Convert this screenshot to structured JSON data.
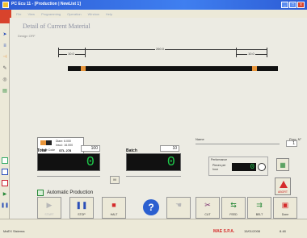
{
  "titlebar": {
    "title": "PC Ecu 11 - [Production | NewList 1]",
    "controls": [
      "_",
      "□",
      "x"
    ]
  },
  "menu": {
    "items": [
      "File",
      "View",
      "Programming",
      "Operation",
      "Window",
      "Help"
    ]
  },
  "header": {
    "title": "Detail of Current Material",
    "view_label": "Design OFF"
  },
  "dimensions": {
    "left": "10.0",
    "total": "260.0",
    "right": "10.0"
  },
  "material": {
    "line1": "Diam: 6.000",
    "line2": "Insul.: 16.000",
    "code_label": "Value Code",
    "code_value": "STL 278"
  },
  "colors": {
    "accent": "#1ec84a",
    "bar": "#111111",
    "strip": "#e8953a",
    "title": "#2c5bd4"
  },
  "counters": {
    "total": {
      "label": "Total",
      "set_value": "100",
      "current": "0"
    },
    "batch": {
      "label": "Batch",
      "set_value": "10",
      "current": "0"
    },
    "middle_button": "M"
  },
  "program": {
    "name_label": "Name",
    "prog_label": "Prog. N°",
    "prog_value": "1"
  },
  "performance": {
    "title": "Performance",
    "line1": "Pieces per",
    "line2": "hour",
    "value": "0"
  },
  "warning": {
    "label": "ABORT"
  },
  "auto_production": {
    "label": "Automatic Production"
  },
  "actions": [
    {
      "label": "START",
      "icon": "play-icon",
      "glyph": "▶",
      "color": "#b8b8b8",
      "disabled": true
    },
    {
      "label": "STOP",
      "icon": "pause-icon",
      "glyph": "❚❚",
      "color": "#2b4fb8",
      "disabled": false
    },
    {
      "label": "HALT",
      "icon": "stop-icon",
      "glyph": "■",
      "color": "#d52b2b",
      "disabled": false
    },
    {
      "label": "",
      "icon": "hand-icon",
      "glyph": "☚",
      "color": "#b8b8b8",
      "disabled": true
    },
    {
      "label": "CUT",
      "icon": "cut-icon",
      "glyph": "✂",
      "color": "#7a2e6e",
      "disabled": false
    },
    {
      "label": "FEED",
      "icon": "feed-icon",
      "glyph": "⇆",
      "color": "#2a8a3a",
      "disabled": false
    },
    {
      "label": "BELT",
      "icon": "belt-icon",
      "glyph": "⇉",
      "color": "#2a8a3a",
      "disabled": false
    },
    {
      "label": "Done",
      "icon": "done-icon",
      "glyph": "▣",
      "color": "#d52b2b",
      "disabled": false
    }
  ],
  "status": {
    "left": "MaEX Sistema",
    "brand": "MAE S.P.A.",
    "date": "15/01/2008",
    "time": "8.48"
  }
}
